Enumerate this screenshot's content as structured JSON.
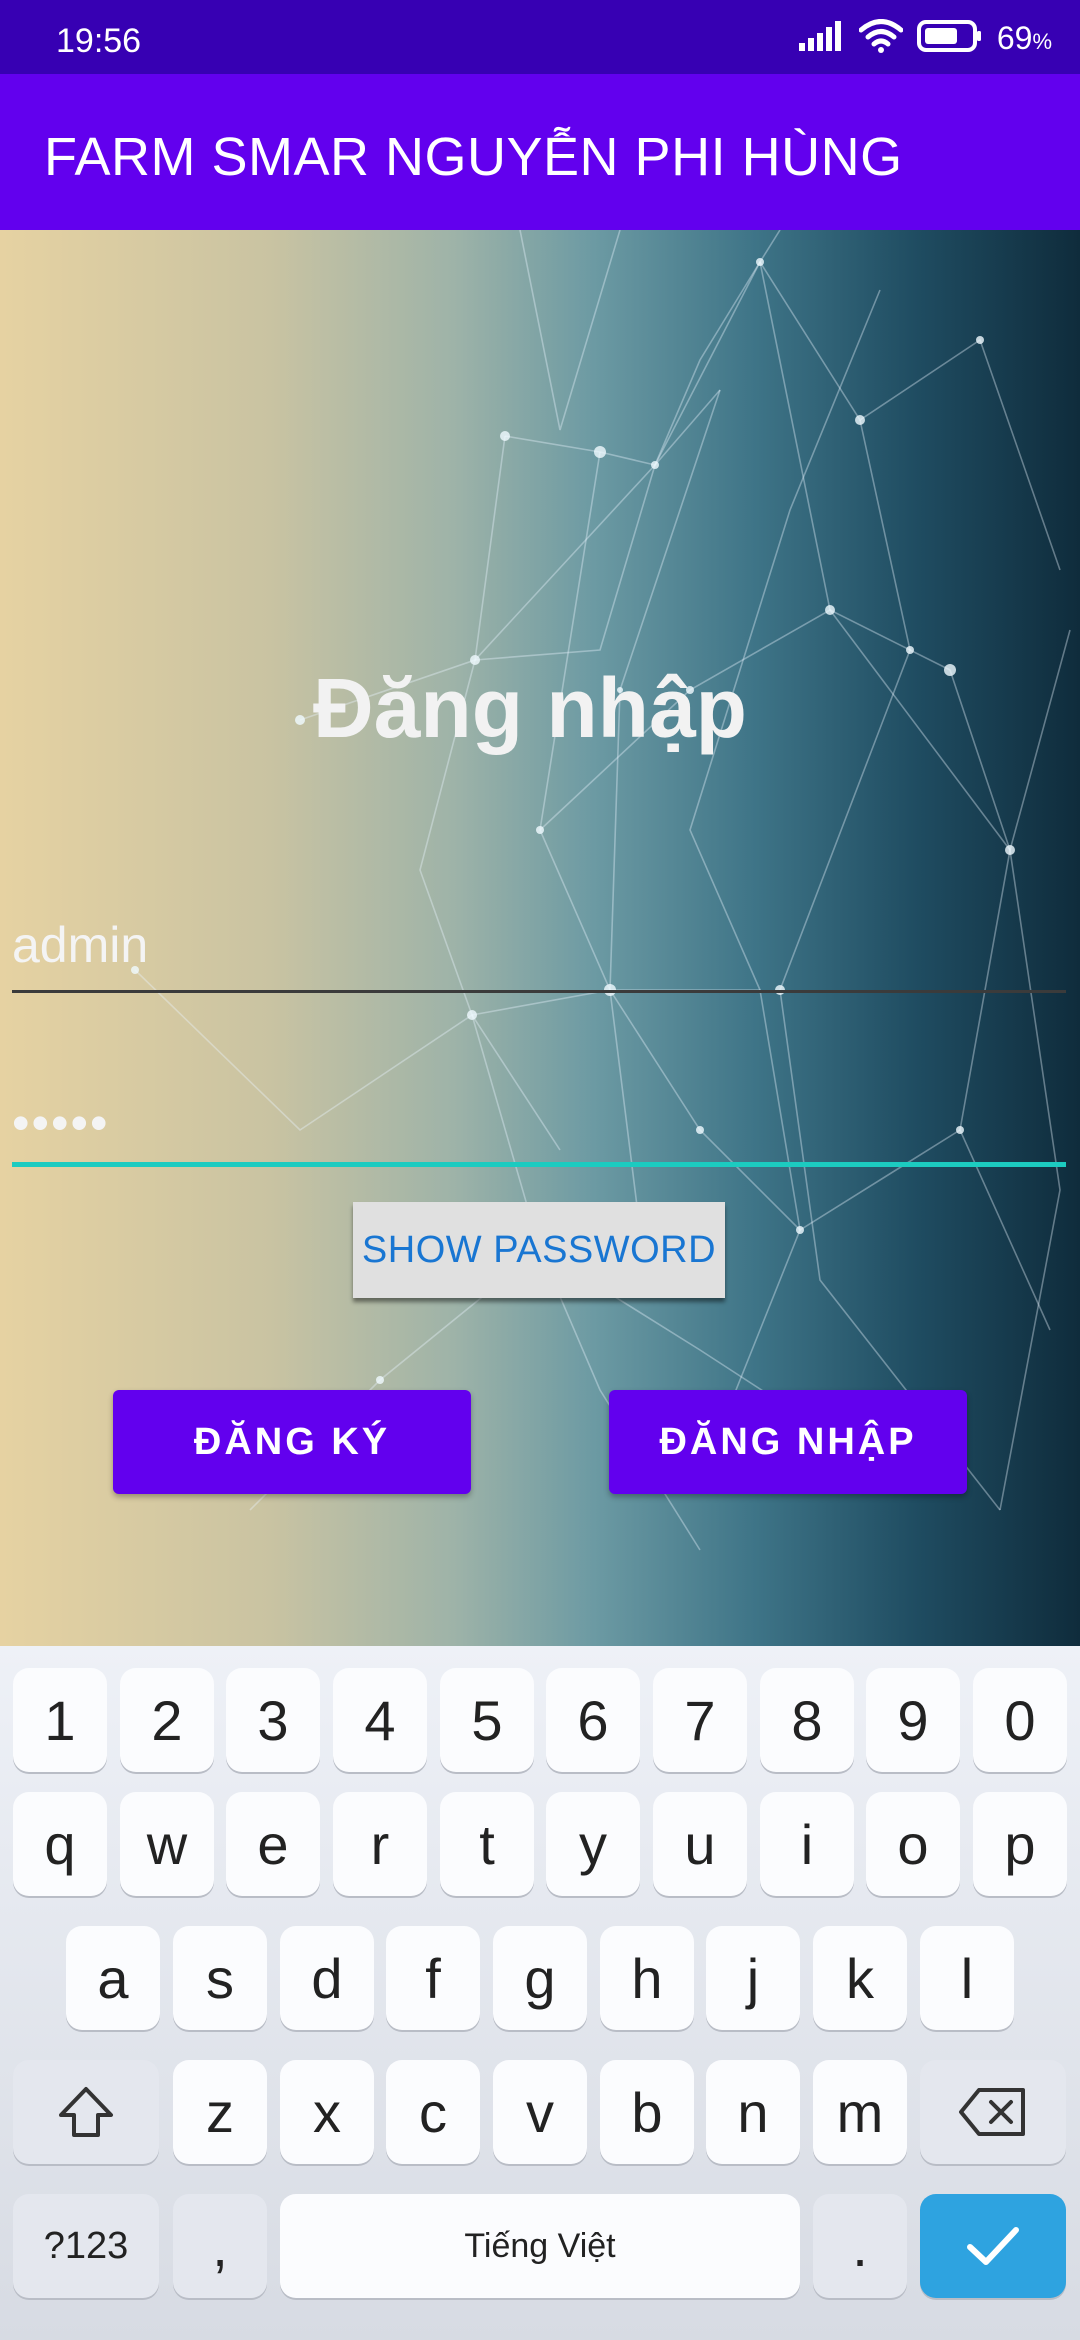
{
  "status_bar": {
    "time": "19:56",
    "battery_percent": "69",
    "battery_unit": "%"
  },
  "app_bar": {
    "title": "FARM SMAR NGUYỄN PHI HÙNG"
  },
  "login": {
    "heading": "Đăng nhập",
    "username_value": "admin",
    "password_value": "•••••",
    "show_password_label": "SHOW PASSWORD",
    "register_label": "ĐĂNG KÝ",
    "login_label": "ĐĂNG NHẬP"
  },
  "keyboard": {
    "row_numbers": [
      "1",
      "2",
      "3",
      "4",
      "5",
      "6",
      "7",
      "8",
      "9",
      "0"
    ],
    "row_1": [
      "q",
      "w",
      "e",
      "r",
      "t",
      "y",
      "u",
      "i",
      "o",
      "p"
    ],
    "row_2": [
      "a",
      "s",
      "d",
      "f",
      "g",
      "h",
      "j",
      "k",
      "l"
    ],
    "row_3": [
      "z",
      "x",
      "c",
      "v",
      "b",
      "n",
      "m"
    ],
    "symbols_label": "?123",
    "comma_label": ",",
    "space_label": "Tiếng Việt",
    "period_label": ".",
    "icons": {
      "shift": "shift-icon",
      "backspace": "backspace-icon",
      "enter": "checkmark-icon"
    }
  },
  "colors": {
    "status_bar": "#3700b3",
    "app_bar": "#6200ee",
    "primary_button": "#6200ee",
    "input_focus": "#1ccbc0",
    "enter_key": "#2ea3e0"
  }
}
